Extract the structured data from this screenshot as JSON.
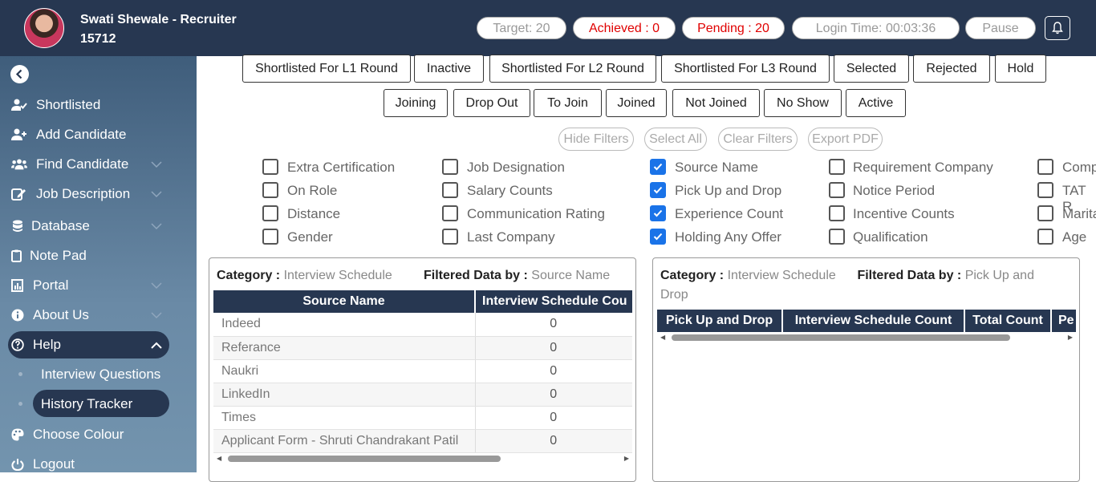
{
  "header": {
    "user_name": "Swati Shewale - Recruiter",
    "user_id": "15712",
    "target": "Target: 20",
    "achieved": "Achieved : 0",
    "pending": "Pending : 20",
    "login_time": "Login Time: 00:03:36",
    "pause": "Pause",
    "icons": [
      "avatar",
      "bell-icon"
    ]
  },
  "sidebar": {
    "items": [
      {
        "label": "Shortlisted",
        "icon": "user-check-icon"
      },
      {
        "label": "Add Candidate",
        "icon": "user-plus-icon"
      },
      {
        "label": "Find Candidate",
        "icon": "users-icon"
      },
      {
        "label": "Job Description",
        "icon": "edit-icon"
      },
      {
        "label": "Database",
        "icon": "database-icon"
      },
      {
        "label": "Note Pad",
        "icon": "clipboard-icon"
      },
      {
        "label": "Portal",
        "icon": "chart-icon"
      },
      {
        "label": "About Us",
        "icon": "info-icon"
      },
      {
        "label": "Help",
        "icon": "question-icon"
      },
      {
        "label": "Choose Colour",
        "icon": "palette-icon"
      },
      {
        "label": "Logout",
        "icon": "power-icon"
      }
    ],
    "help_sub": [
      "Interview Questions",
      "History Tracker"
    ]
  },
  "status_buttons": {
    "row1": [
      "Shortlisted For L1 Round",
      "Inactive",
      "Shortlisted For L2 Round",
      "Shortlisted For L3 Round",
      "Selected",
      "Rejected",
      "Hold"
    ],
    "row2": [
      "Joining",
      "Drop Out",
      "To Join",
      "Joined",
      "Not Joined",
      "No Show",
      "Active"
    ]
  },
  "filter_buttons": [
    "Hide Filters",
    "Select All",
    "Clear Filters",
    "Export PDF"
  ],
  "filters": [
    {
      "label": "Extra Certification",
      "checked": false
    },
    {
      "label": "On Role",
      "checked": false
    },
    {
      "label": "Distance",
      "checked": false
    },
    {
      "label": "Gender",
      "checked": false
    },
    {
      "label": "Job Designation",
      "checked": false
    },
    {
      "label": "Salary Counts",
      "checked": false
    },
    {
      "label": "Communication Rating",
      "checked": false
    },
    {
      "label": "Last Company",
      "checked": false
    },
    {
      "label": "Source Name",
      "checked": true
    },
    {
      "label": "Pick Up and Drop",
      "checked": true
    },
    {
      "label": "Experience Count",
      "checked": true
    },
    {
      "label": "Holding Any Offer",
      "checked": true
    },
    {
      "label": "Requirement Company",
      "checked": false
    },
    {
      "label": "Notice Period",
      "checked": false
    },
    {
      "label": "Incentive Counts",
      "checked": false
    },
    {
      "label": "Qualification",
      "checked": false
    },
    {
      "label": "Comp",
      "checked": false
    },
    {
      "label": "TAT R",
      "checked": false
    },
    {
      "label": "Marita",
      "checked": false
    },
    {
      "label": "Age",
      "checked": false
    }
  ],
  "card1": {
    "category_label": "Category :",
    "category": "Interview Schedule",
    "filtered_label": "Filtered Data by :",
    "filtered": "Source Name",
    "columns": [
      "Source Name",
      "Interview Schedule Cou"
    ],
    "rows": [
      [
        "Indeed",
        "0"
      ],
      [
        "Referance",
        "0"
      ],
      [
        "Naukri",
        "0"
      ],
      [
        "LinkedIn",
        "0"
      ],
      [
        "Times",
        "0"
      ],
      [
        "Applicant Form - Shruti Chandrakant Patil",
        "0"
      ]
    ]
  },
  "card2": {
    "category_label": "Category :",
    "category": "Interview Schedule",
    "filtered_label": "Filtered Data by :",
    "filtered": "Pick Up and Drop",
    "columns": [
      "Pick Up and Drop",
      "Interview Schedule Count",
      "Total Count",
      "Pe"
    ]
  }
}
